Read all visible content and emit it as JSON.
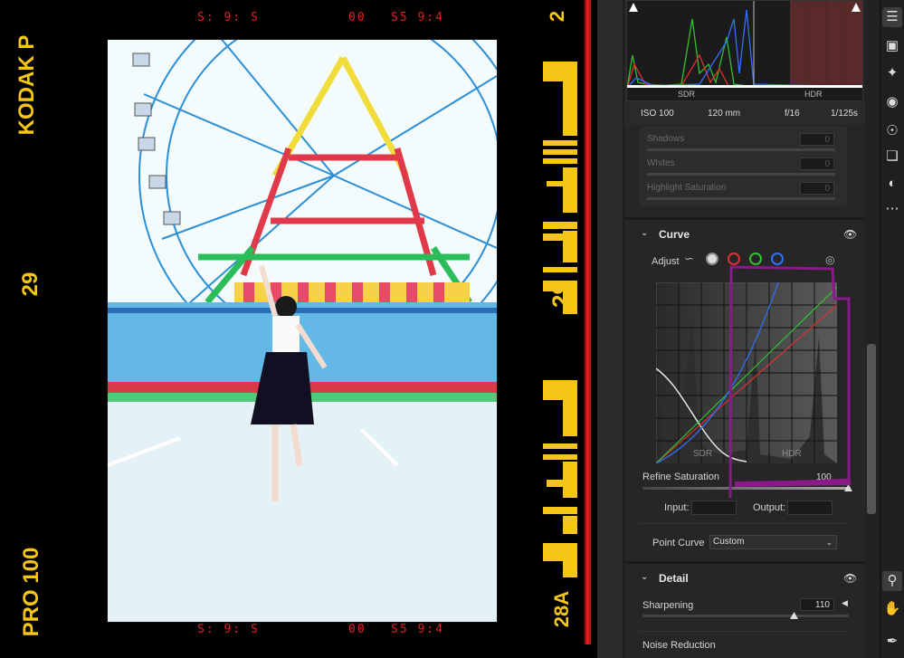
{
  "film": {
    "brand": "KODAK P",
    "frame_number": "29",
    "frame_number_right": "29",
    "stock": "PRO 100",
    "frame_right_bottom": "28A",
    "corner_top_right": "2",
    "red_codes_top": [
      "S: 9: S",
      "00",
      "S5 9:4"
    ],
    "red_codes_bottom": [
      "S: 9: S",
      "00",
      "S5 9:4"
    ]
  },
  "histogram": {
    "sdr_label": "SDR",
    "hdr_label": "HDR"
  },
  "exif": {
    "iso": "ISO 100",
    "focal": "120 mm",
    "aperture": "f/16",
    "shutter": "1/125s"
  },
  "light_sliders": [
    {
      "label": "Shadows",
      "value": "0"
    },
    {
      "label": "Whites",
      "value": "0"
    },
    {
      "label": "Highlight Saturation",
      "value": "0"
    }
  ],
  "curve": {
    "title": "Curve",
    "adjust_label": "Adjust",
    "sdr_label": "SDR",
    "hdr_label": "HDR",
    "refine_label": "Refine Saturation",
    "refine_value": "100",
    "refine_fraction": 1.0,
    "input_label": "Input:",
    "output_label": "Output:",
    "point_curve_label": "Point Curve",
    "point_curve_value": "Custom"
  },
  "detail": {
    "title": "Detail",
    "sharpening_label": "Sharpening",
    "sharpening_value": "110",
    "sharpening_fraction": 0.73,
    "noise_label": "Noise Reduction"
  },
  "colors": {
    "annotation": "#8a1a8a",
    "red_channel": "#e03030",
    "green_channel": "#30c030",
    "blue_channel": "#3070ff"
  },
  "tools": [
    "edit-icon",
    "crop-icon",
    "heal-icon",
    "mask-icon",
    "redeye-icon",
    "presets-icon",
    "mix-icon",
    "more-icon",
    "zoom-icon",
    "hand-icon",
    "eyedropper-icon"
  ]
}
